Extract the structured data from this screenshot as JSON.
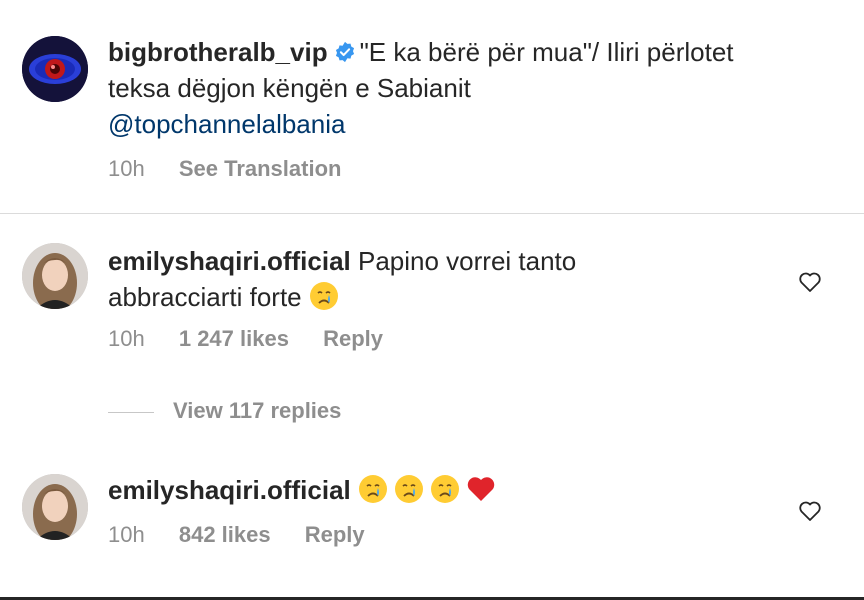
{
  "post": {
    "username": "bigbrotheralb_vip",
    "caption_line1": "\"E ka bërë për mua\"/ Iliri përlotet",
    "caption_line2": "teksa dëgjon këngën e Sabianit",
    "mention": "@topchannelalbania",
    "time": "10h",
    "see_translation": "See Translation"
  },
  "comments": [
    {
      "username": "emilyshaqiri.official",
      "text_line1": "Papino vorrei tanto",
      "text_line2": "abbracciarti forte",
      "emojis": [
        "crying-face"
      ],
      "time": "10h",
      "likes": "1 247 likes",
      "reply": "Reply"
    },
    {
      "username": "emilyshaqiri.official",
      "emojis": [
        "crying-face",
        "crying-face",
        "crying-face",
        "red-heart"
      ],
      "time": "10h",
      "likes": "842 likes",
      "reply": "Reply"
    }
  ],
  "view_replies": "View 117 replies",
  "colors": {
    "text": "#262626",
    "muted": "#8e8e8e",
    "link": "#00376b",
    "verified": "#3897f0",
    "heart": "#e0242b"
  }
}
